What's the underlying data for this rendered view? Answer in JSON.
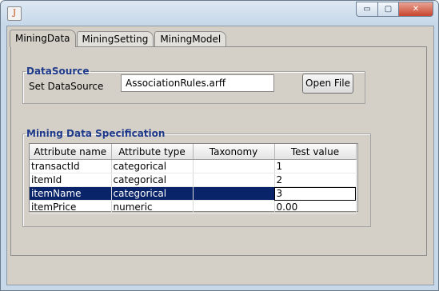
{
  "window": {
    "controls": {
      "minimize": "▭",
      "maximize": "▢",
      "close": "✕"
    }
  },
  "tabs": [
    {
      "label": "MiningData",
      "active": true
    },
    {
      "label": "MiningSetting",
      "active": false
    },
    {
      "label": "MiningModel",
      "active": false
    }
  ],
  "datasource": {
    "legend": "DataSource",
    "label": "Set DataSource",
    "value": "AssociationRules.arff",
    "button": "Open File"
  },
  "spec": {
    "legend": "Mining Data Specification",
    "columns": [
      "Attribute name",
      "Attribute type",
      "Taxonomy",
      "Test value"
    ],
    "rows": [
      [
        "transactId",
        "categorical",
        "",
        "1"
      ],
      [
        "itemId",
        "categorical",
        "",
        "2"
      ],
      [
        "itemName",
        "categorical",
        "",
        "3"
      ],
      [
        "itemPrice",
        "numeric",
        "",
        "0.00"
      ]
    ],
    "selected_row": 2
  },
  "colors": {
    "legend": "#1f3a8a",
    "selection": "#0a246a",
    "panel": "#d4d0c8"
  }
}
